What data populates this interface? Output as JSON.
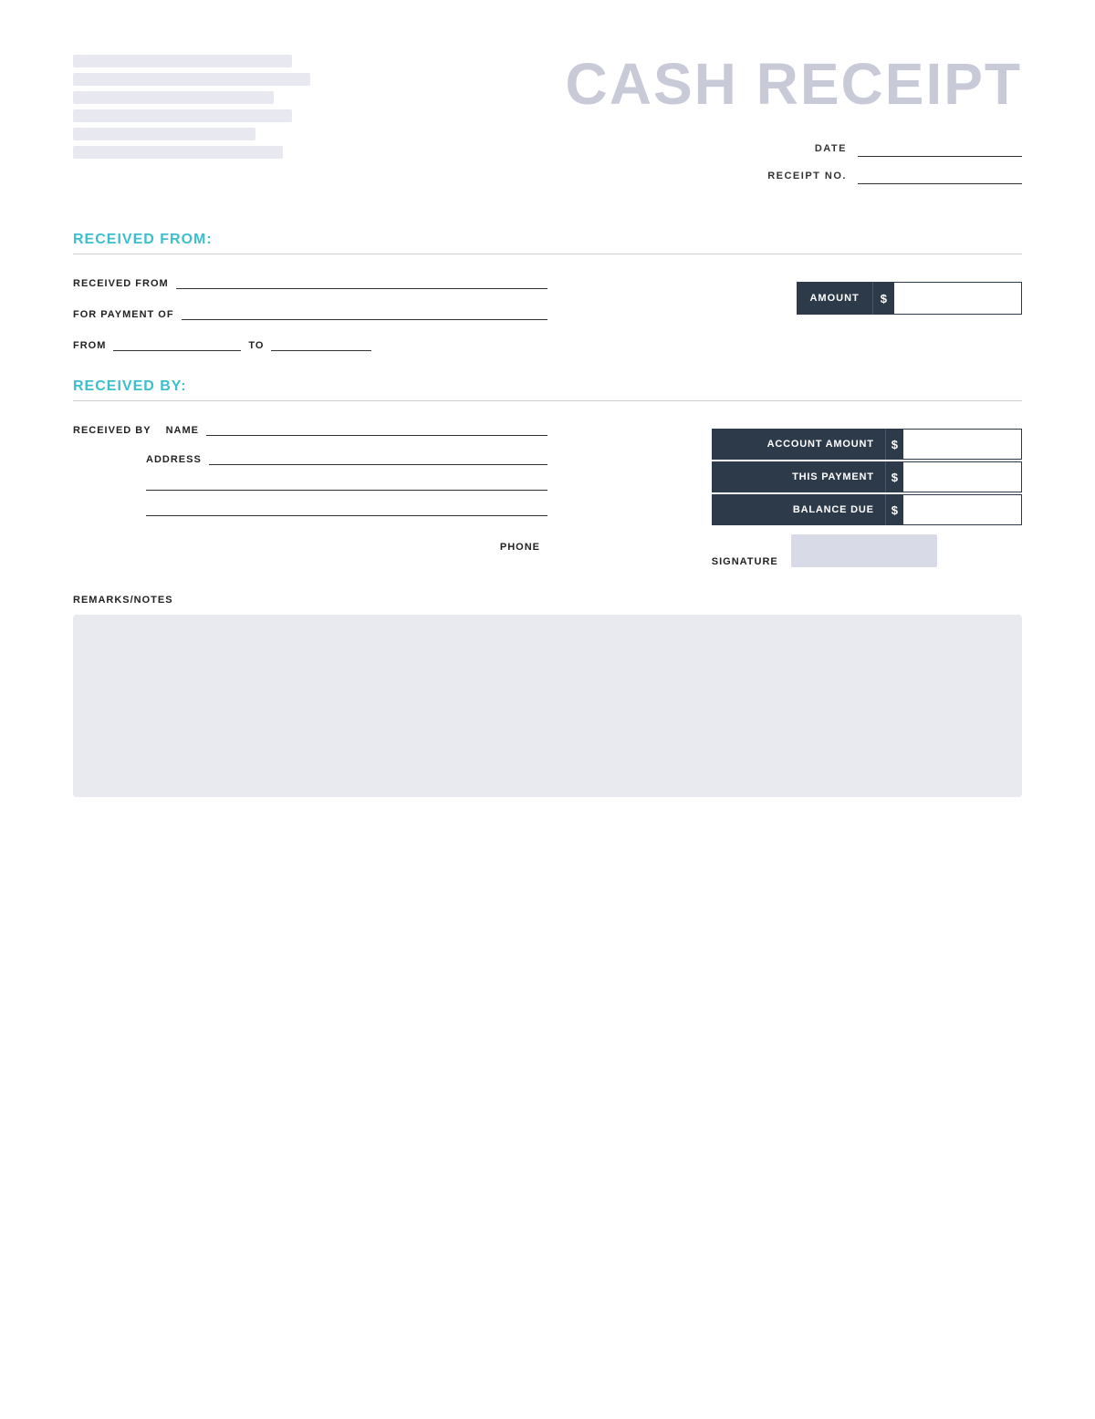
{
  "title": "CASH RECEIPT",
  "header": {
    "date_label": "DATE",
    "receipt_no_label": "RECEIPT NO."
  },
  "received_from_section": {
    "title": "RECEIVED FROM:",
    "received_from_label": "RECEIVED FROM",
    "for_payment_label": "FOR PAYMENT OF",
    "from_label": "FROM",
    "to_label": "TO",
    "amount_label": "AMOUNT",
    "dollar_sign": "$"
  },
  "received_by_section": {
    "title": "RECEIVED BY:",
    "received_by_label": "RECEIVED BY",
    "name_label": "NAME",
    "address_label": "ADDRESS",
    "phone_label": "PHONE",
    "account_amount_label": "ACCOUNT AMOUNT",
    "this_payment_label": "THIS PAYMENT",
    "balance_due_label": "BALANCE DUE",
    "dollar_sign": "$",
    "signature_label": "SIGNATURE"
  },
  "remarks_section": {
    "label": "REMARKS/NOTES"
  }
}
